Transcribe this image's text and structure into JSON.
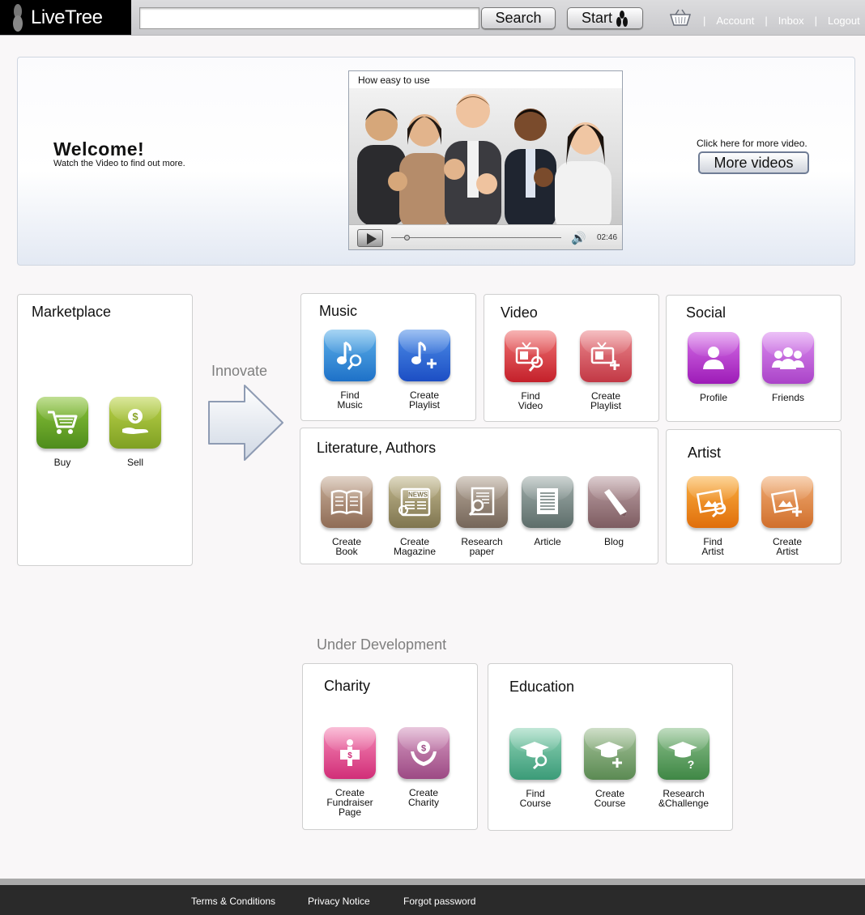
{
  "header": {
    "logo_text": "LiveTree",
    "search_placeholder": "",
    "search_button": "Search",
    "start_button": "Start",
    "links": [
      "Account",
      "Inbox",
      "Logout"
    ],
    "separator": "|"
  },
  "welcome": {
    "title": "Welcome!",
    "subtitle": "Watch the Video to find out more.",
    "video_title": "How easy to use",
    "video_time": "02:46",
    "more_hint": "Click here for more video.",
    "more_button": "More videos"
  },
  "innovate_label": "Innovate",
  "under_development_label": "Under Development",
  "marketplace": {
    "title": "Marketplace",
    "items": [
      {
        "label": "Buy",
        "icon": "cart-icon",
        "color": "#5f9e25"
      },
      {
        "label": "Sell",
        "icon": "hand-coin-icon",
        "color": "#94b62c"
      }
    ]
  },
  "music": {
    "title": "Music",
    "items": [
      {
        "label": "Find\nMusic",
        "icon": "music-search-icon",
        "color": "#2f88d8"
      },
      {
        "label": "Create\nPlaylist",
        "icon": "music-add-icon",
        "color": "#2a5fd0"
      }
    ]
  },
  "video": {
    "title": "Video",
    "items": [
      {
        "label": "Find\nVideo",
        "icon": "tv-search-icon",
        "color": "#d23b43"
      },
      {
        "label": "Create\nPlaylist",
        "icon": "tv-add-icon",
        "color": "#cf535c"
      }
    ]
  },
  "social": {
    "title": "Social",
    "items": [
      {
        "label": "Profile",
        "icon": "person-icon",
        "color": "#a928c2"
      },
      {
        "label": "Friends",
        "icon": "group-icon",
        "color": "#b754d2"
      }
    ]
  },
  "literature": {
    "title": "Literature, Authors",
    "items": [
      {
        "label": "Create\nBook",
        "icon": "book-icon",
        "color": "#9c7b65"
      },
      {
        "label": "Create\nMagazine",
        "icon": "newspaper-icon",
        "color": "#8b8260"
      },
      {
        "label": "Research\npaper",
        "icon": "paper-search-icon",
        "color": "#81726a"
      },
      {
        "label": "Article",
        "icon": "article-icon",
        "color": "#6d7c79"
      },
      {
        "label": "Blog",
        "icon": "pencil-icon",
        "color": "#8b6b70"
      }
    ]
  },
  "artist": {
    "title": "Artist",
    "items": [
      {
        "label": "Find\nArtist",
        "icon": "picture-search-icon",
        "color": "#e97d17"
      },
      {
        "label": "Create\nArtist",
        "icon": "picture-add-icon",
        "color": "#d97c38"
      }
    ]
  },
  "charity": {
    "title": "Charity",
    "items": [
      {
        "label": "Create\nFundraiser\nPage",
        "icon": "fundraiser-icon",
        "color": "#da3f85"
      },
      {
        "label": "Create\nCharity",
        "icon": "charity-hands-icon",
        "color": "#a65a90"
      }
    ]
  },
  "education": {
    "title": "Education",
    "items": [
      {
        "label": "Find\nCourse",
        "icon": "grad-search-icon",
        "color": "#4aa884"
      },
      {
        "label": "Create\nCourse",
        "icon": "grad-add-icon",
        "color": "#68975f"
      },
      {
        "label": "Research\n&Challenge",
        "icon": "grad-question-icon",
        "color": "#4c9150"
      }
    ]
  },
  "footer": {
    "links": [
      "Terms & Conditions",
      "Privacy Notice",
      "Forgot password"
    ]
  }
}
